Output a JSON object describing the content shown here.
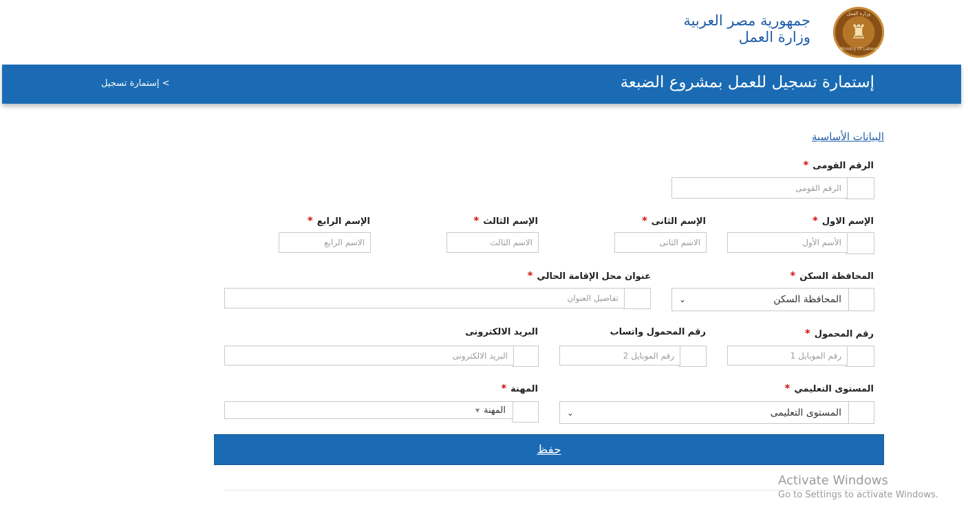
{
  "header": {
    "country": "جمهورية مصر العربية",
    "ministry": "وزارة العمل",
    "logo_top_text": "وزارة العمل",
    "logo_bottom_text": "Ministry Of Labour"
  },
  "banner": {
    "title": "إستمارة تسجيل للعمل بمشروع الضبعة",
    "breadcrumb": "> إستمارة تسجيل"
  },
  "section": {
    "title": "البيانات الأساسية"
  },
  "fields": {
    "national_id": {
      "label": "الرقم القومى",
      "placeholder": "الرقم القومى",
      "required": "*"
    },
    "first_name": {
      "label": "الإسم الاول",
      "placeholder": "الأسم الأول",
      "required": "*"
    },
    "second_name": {
      "label": "الإسم الثانى",
      "placeholder": "الاسم الثانى",
      "required": "*"
    },
    "third_name": {
      "label": "الإسم الثالث",
      "placeholder": "الاسم الثالث",
      "required": "*"
    },
    "fourth_name": {
      "label": "الإسم الرابع",
      "placeholder": "الاسم الرابع",
      "required": "*"
    },
    "governorate": {
      "label": "المحافظة السكن",
      "value": "المحافظة السكن",
      "required": "*"
    },
    "address": {
      "label": "عنوان محل الإقامة الحالي",
      "placeholder": "تفاصيل العنوان",
      "required": "*"
    },
    "mobile": {
      "label": "رقم المحمول",
      "placeholder": "رقم الموبايل 1",
      "required": "*"
    },
    "whatsapp": {
      "label": "رقم المحمول واتساب",
      "placeholder": "رقم الموبايل 2"
    },
    "email": {
      "label": "البريد الالكترونى",
      "placeholder": "البريد الالكترونى"
    },
    "education": {
      "label": "المستوى التعليمي",
      "value": "المستوى التعليمى",
      "required": "*"
    },
    "profession": {
      "label": "المهنة",
      "value": "المهنة",
      "required": "*"
    }
  },
  "save_label": "حفظ",
  "watermark": {
    "line1": "Activate Windows",
    "line2": "Go to Settings to activate Windows."
  },
  "colors": {
    "primary": "#1a6bb3",
    "required": "#d01010",
    "title_text": "#1f5da8"
  }
}
